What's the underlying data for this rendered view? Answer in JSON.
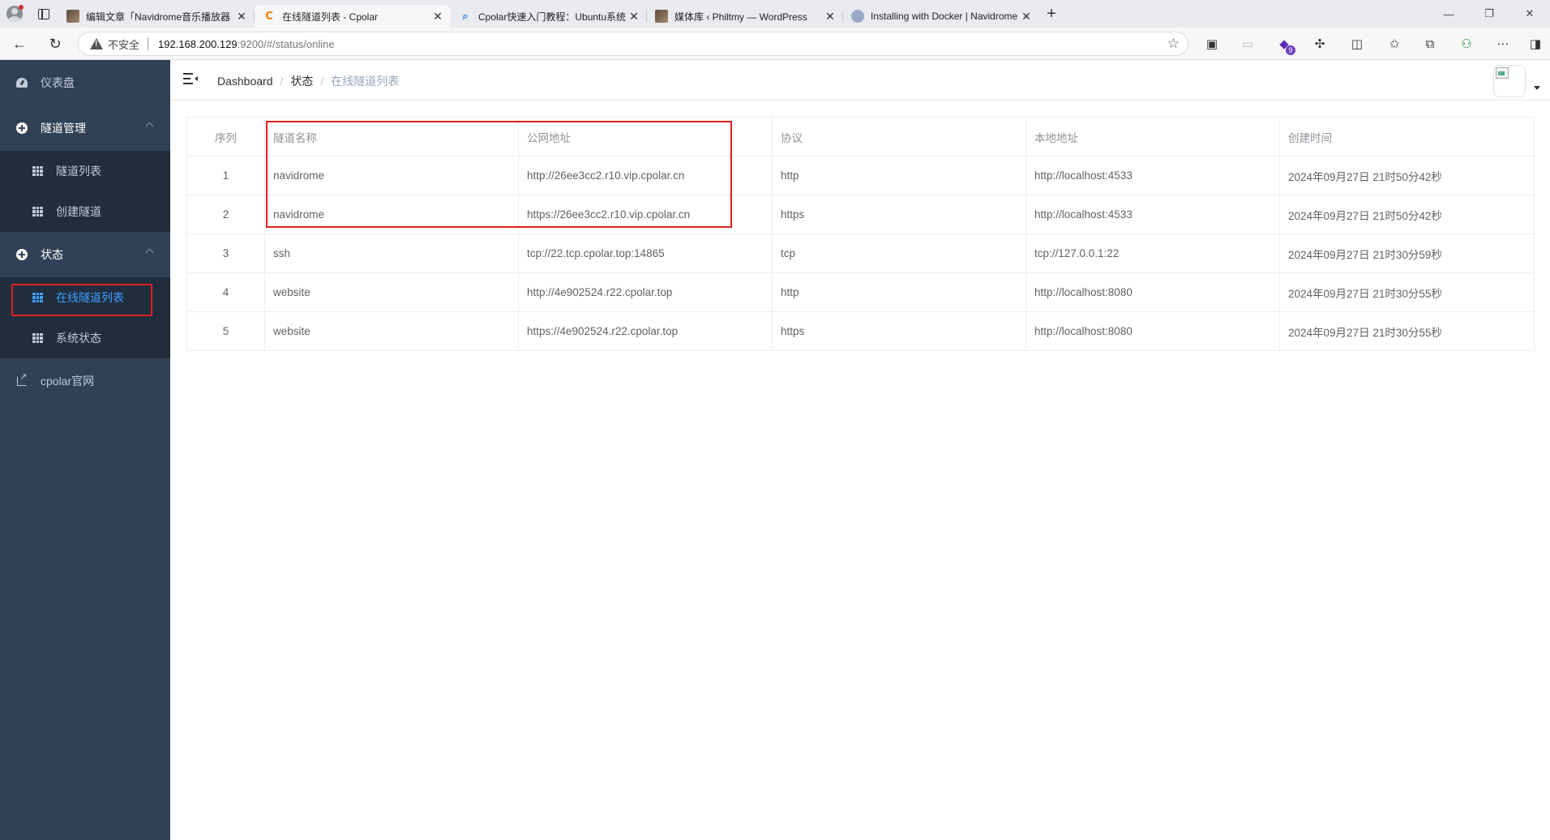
{
  "browser": {
    "tabs": [
      {
        "title": "编辑文章「Navidrome音乐播放器",
        "favicon": "wp-icon",
        "active": false
      },
      {
        "title": "在线隧道列表 - Cpolar",
        "favicon": "cpolar-icon",
        "active": true
      },
      {
        "title": "Cpolar快速入门教程：Ubuntu系统",
        "favicon": "search-icon",
        "active": false
      },
      {
        "title": "媒体库 ‹ Philtmy — WordPress",
        "favicon": "wp-icon",
        "active": false
      },
      {
        "title": "Installing with Docker | Navidrome",
        "favicon": "navidrome-icon",
        "active": false
      }
    ],
    "address": {
      "insecure_label": "不安全",
      "host": "192.168.200.129",
      "path": ":9200/#/status/online"
    },
    "extension_badge": "9"
  },
  "sidebar": {
    "dashboard": "仪表盘",
    "tunnel_mgmt": {
      "label": "隧道管理",
      "items": [
        "隧道列表",
        "创建隧道"
      ]
    },
    "status": {
      "label": "状态",
      "items": [
        "在线隧道列表",
        "系统状态"
      ]
    },
    "website": "cpolar官网"
  },
  "navbar": {
    "breadcrumb": [
      "Dashboard",
      "状态",
      "在线隧道列表"
    ],
    "separator": "/"
  },
  "table": {
    "columns": [
      "序列",
      "隧道名称",
      "公网地址",
      "协议",
      "本地地址",
      "创建时间"
    ],
    "rows": [
      [
        "1",
        "navidrome",
        "http://26ee3cc2.r10.vip.cpolar.cn",
        "http",
        "http://localhost:4533",
        "2024年09月27日 21时50分42秒"
      ],
      [
        "2",
        "navidrome",
        "https://26ee3cc2.r10.vip.cpolar.cn",
        "https",
        "http://localhost:4533",
        "2024年09月27日 21时50分42秒"
      ],
      [
        "3",
        "ssh",
        "tcp://22.tcp.cpolar.top:14865",
        "tcp",
        "tcp://127.0.0.1:22",
        "2024年09月27日 21时30分59秒"
      ],
      [
        "4",
        "website",
        "http://4e902524.r22.cpolar.top",
        "http",
        "http://localhost:8080",
        "2024年09月27日 21时30分55秒"
      ],
      [
        "5",
        "website",
        "https://4e902524.r22.cpolar.top",
        "https",
        "http://localhost:8080",
        "2024年09月27日 21时30分55秒"
      ]
    ]
  },
  "colors": {
    "sidebar_bg": "#304156",
    "submenu_bg": "#1f2d3d",
    "active_text": "#409eff",
    "highlight_border": "#e02020"
  }
}
